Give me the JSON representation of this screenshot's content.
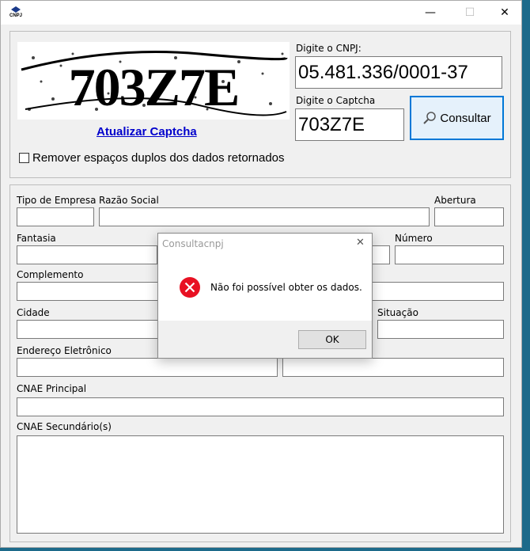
{
  "app": {
    "icon_label": "CNPJ",
    "icon": "app-logo-icon"
  },
  "titlebar": {
    "min": "—",
    "max": "☐",
    "close": "✕"
  },
  "captcha": {
    "text": "703Z7E",
    "refresh_link": "Atualizar Captcha",
    "cnpj_label": "Digite o CNPJ:",
    "cnpj_value": "05.481.336/0001-37",
    "captcha_label": "Digite o Captcha",
    "captcha_value": "703Z7E",
    "consultar_label": "Consultar",
    "remove_spaces_label": "Remover espaços duplos dos dados retornados"
  },
  "form": {
    "tipo_empresa": "Tipo de Empresa",
    "razao_social": "Razão Social",
    "abertura": "Abertura",
    "fantasia": "Fantasia",
    "numero": "Número",
    "complemento": "Complemento",
    "cidade": "Cidade",
    "situacao": "Situação",
    "endereco_eletronico": "Endereço Eletrônico",
    "cnae_principal": "CNAE Principal",
    "cnae_secundario": "CNAE Secundário(s)"
  },
  "dialog": {
    "title": "Consultacnpj",
    "close": "✕",
    "message": "Não foi possível obter os dados.",
    "ok_label": "OK",
    "icon": "error-icon",
    "error_color": "#e81123"
  }
}
